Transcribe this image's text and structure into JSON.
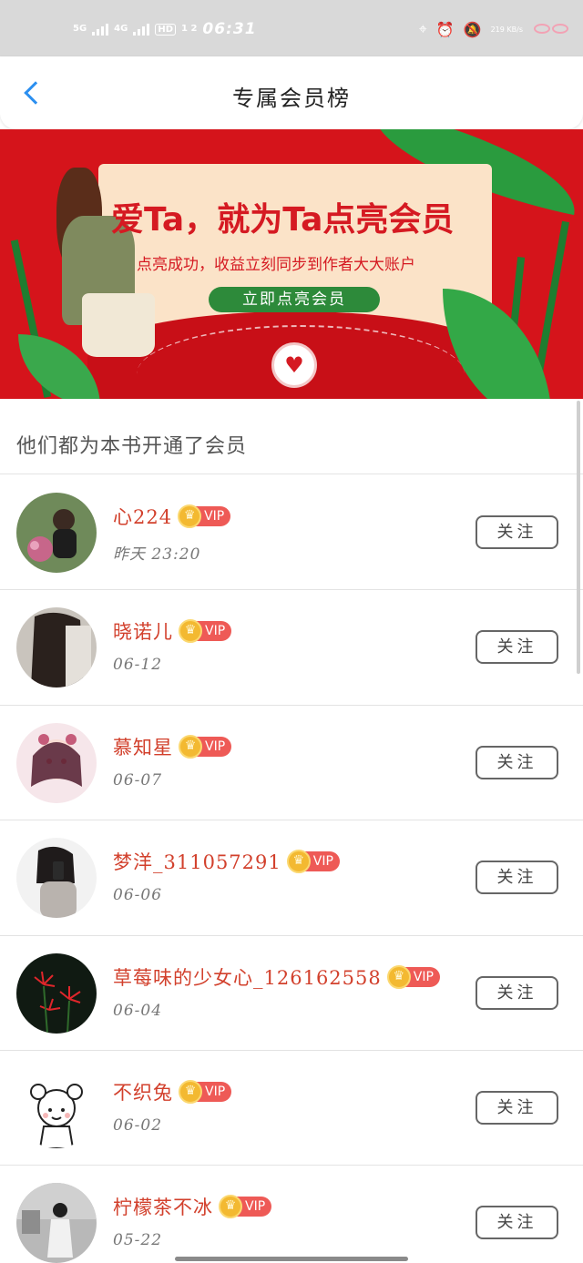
{
  "status_bar": {
    "net1": "5G",
    "net2": "4G",
    "hd": "HD",
    "hd_sub": "1 2",
    "time": "06:31",
    "speed": "219 KB/s"
  },
  "header": {
    "title": "专属会员榜"
  },
  "banner": {
    "headline": "爱Ta，就为Ta点亮会员",
    "subline": "点亮成功，收益立刻同步到作者大大账户",
    "button": "立即点亮会员"
  },
  "section_title": "他们都为本书开通了会员",
  "vip_label": "VIP",
  "follow_label": "关注",
  "members": [
    {
      "name": "心224",
      "time": "昨天 23:20",
      "avatar": "photo-girl-flowers"
    },
    {
      "name": "晓诺儿",
      "time": "06-12",
      "avatar": "photo-dark-hair"
    },
    {
      "name": "慕知星",
      "time": "06-07",
      "avatar": "anime-girl"
    },
    {
      "name": "梦洋_311057291",
      "time": "06-06",
      "avatar": "photo-girl-phone"
    },
    {
      "name": "草莓味的少女心_126162558",
      "time": "06-04",
      "avatar": "red-spider-lily"
    },
    {
      "name": "不织兔",
      "time": "06-02",
      "avatar": "cartoon-girl"
    },
    {
      "name": "柠檬茶不冰",
      "time": "05-22",
      "avatar": "photo-street-girl"
    }
  ],
  "colors": {
    "accent_blue": "#2b8ff0",
    "name_red": "#d2402c",
    "banner_red": "#d5141b",
    "vip_red": "#ee5a56",
    "crown_gold": "#f3b931"
  }
}
